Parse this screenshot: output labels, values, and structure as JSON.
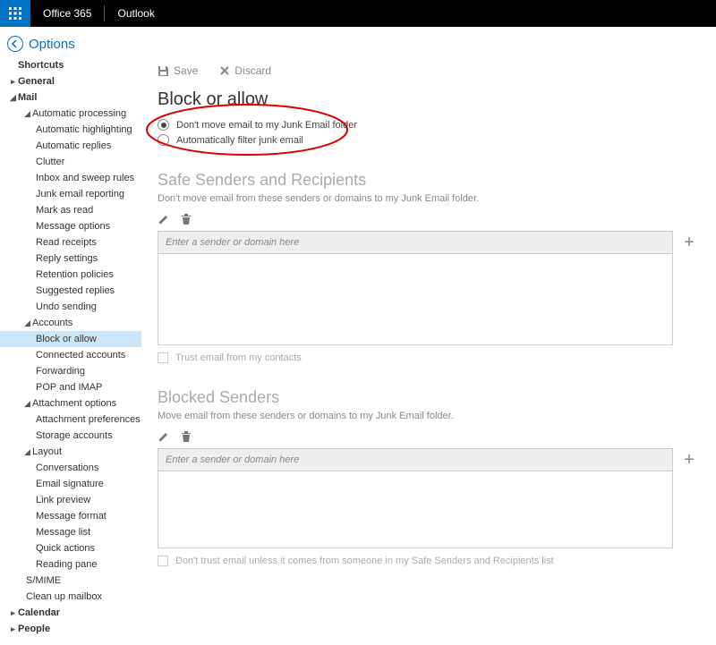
{
  "topbar": {
    "brand": "Office 365",
    "app": "Outlook"
  },
  "back": {
    "title": "Options"
  },
  "sidebar": {
    "shortcuts": "Shortcuts",
    "general": "General",
    "mail": "Mail",
    "autoproc": "Automatic processing",
    "autoproc_items": [
      "Automatic highlighting",
      "Automatic replies",
      "Clutter",
      "Inbox and sweep rules",
      "Junk email reporting",
      "Mark as read",
      "Message options",
      "Read receipts",
      "Reply settings",
      "Retention policies",
      "Suggested replies",
      "Undo sending"
    ],
    "accounts": "Accounts",
    "accounts_items": [
      "Block or allow",
      "Connected accounts",
      "Forwarding",
      "POP and IMAP"
    ],
    "attach": "Attachment options",
    "attach_items": [
      "Attachment preferences",
      "Storage accounts"
    ],
    "layout": "Layout",
    "layout_items": [
      "Conversations",
      "Email signature",
      "Link preview",
      "Message format",
      "Message list",
      "Quick actions",
      "Reading pane"
    ],
    "smime": "S/MIME",
    "cleanup": "Clean up mailbox",
    "calendar": "Calendar",
    "people": "People"
  },
  "toolbar": {
    "save": "Save",
    "discard": "Discard"
  },
  "page": {
    "title": "Block or allow",
    "opt1": "Don't move email to my Junk Email folder",
    "opt2": "Automatically filter junk email"
  },
  "safe": {
    "title": "Safe Senders and Recipients",
    "desc": "Don't move email from these senders or domains to my Junk Email folder.",
    "placeholder": "Enter a sender or domain here",
    "trust": "Trust email from my contacts"
  },
  "blocked": {
    "title": "Blocked Senders",
    "desc": "Move email from these senders or domains to my Junk Email folder.",
    "placeholder": "Enter a sender or domain here",
    "dont_trust": "Don't trust email unless it comes from someone in my Safe Senders and Recipients list"
  }
}
